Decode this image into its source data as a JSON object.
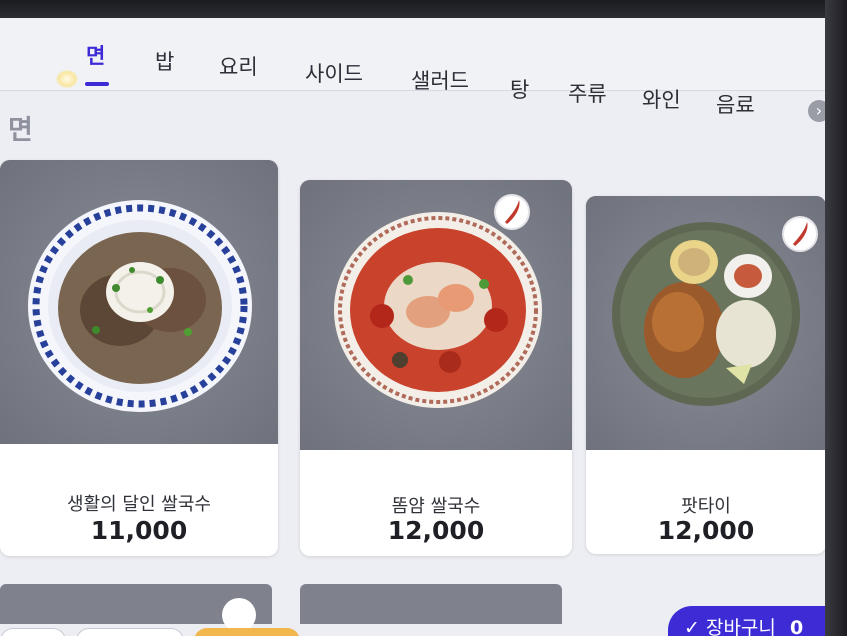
{
  "tabs": [
    {
      "label": "면"
    },
    {
      "label": "밥"
    },
    {
      "label": "요리"
    },
    {
      "label": "사이드"
    },
    {
      "label": "샐러드"
    },
    {
      "label": "탕"
    },
    {
      "label": "주류"
    },
    {
      "label": "와인"
    },
    {
      "label": "음료"
    }
  ],
  "section": {
    "title": "면"
  },
  "menu_items": [
    {
      "name": "생활의 달인 쌀국수",
      "price": "11,000",
      "spicy": false
    },
    {
      "name": "똠얌 쌀국수",
      "price": "12,000",
      "spicy": true
    },
    {
      "name": "팟타이",
      "price": "12,000",
      "spicy": true
    }
  ],
  "cart": {
    "label": "장바구니",
    "count": "0"
  },
  "colors": {
    "accent": "#3d2bd6",
    "spicy": "#c0392b"
  }
}
